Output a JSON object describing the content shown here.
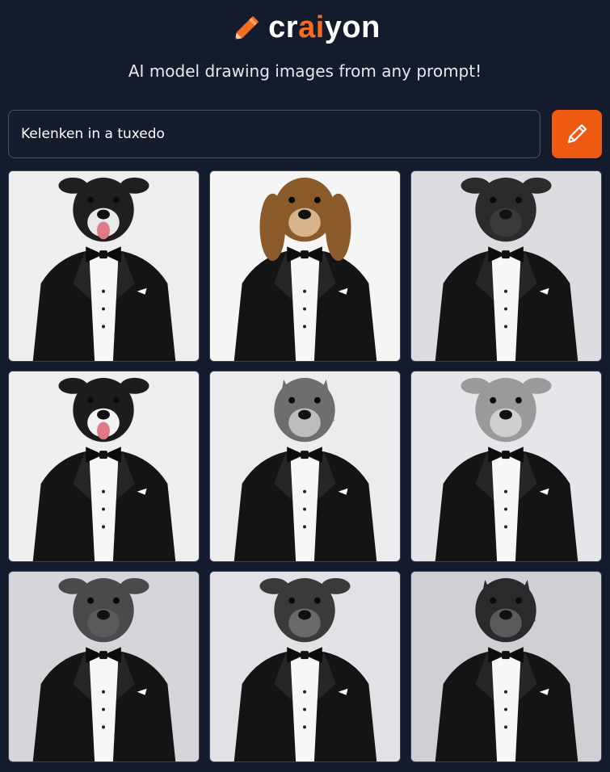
{
  "header": {
    "logo_prefix": "cr",
    "logo_accent": "ai",
    "logo_suffix": "yon",
    "logo_icon": "pencil-icon",
    "tagline": "AI model drawing images from any prompt!"
  },
  "prompt": {
    "value": "Kelenken in a tuxedo",
    "button_icon": "pencil-icon"
  },
  "results": {
    "count": 9,
    "subject": "dog in a black tuxedo with bow tie"
  },
  "colors": {
    "background": "#141b2d",
    "accent": "#f26d21",
    "button": "#ee5a12"
  }
}
